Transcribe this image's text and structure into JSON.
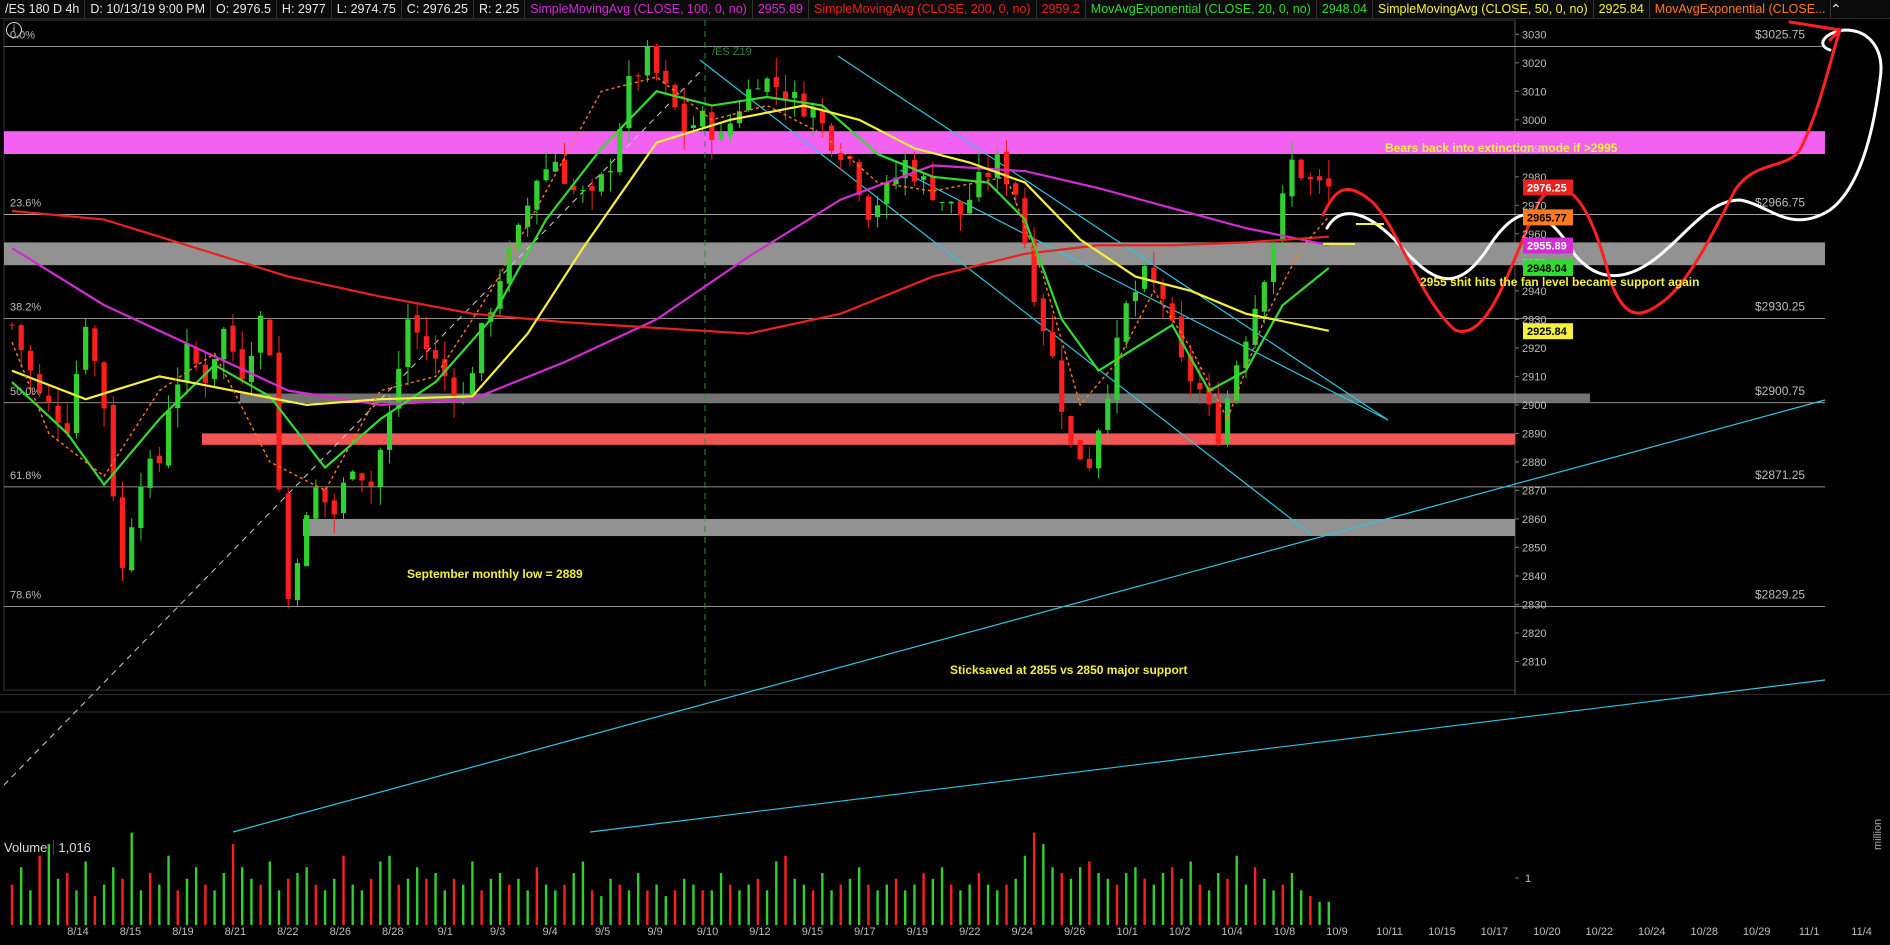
{
  "header": {
    "symbol": "/ES 180 D 4h",
    "date": "D: 10/13/19 9:00 PM",
    "open": "O: 2976.5",
    "high": "H: 2977",
    "low": "L: 2974.75",
    "close": "C: 2976.25",
    "range": "R: 2.25",
    "studies": [
      {
        "label": "SimpleMovingAvg (CLOSE, 100, 0, no)",
        "value": "2955.89",
        "color": "#d22cd2"
      },
      {
        "label": "SimpleMovingAvg (CLOSE, 200, 0, no)",
        "value": "2959.2",
        "color": "#e8221c"
      },
      {
        "label": "MovAvgExponential (CLOSE, 20, 0, no)",
        "value": "2948.04",
        "color": "#2fdc2f"
      },
      {
        "label": "SimpleMovingAvg (CLOSE, 50, 0, no)",
        "value": "2925.84",
        "color": "#f5f03a"
      },
      {
        "label": "MovAvgExponential (CLOSE...",
        "value": "",
        "color": "#ff7a1a"
      }
    ]
  },
  "volume_panel": {
    "title": "Volume",
    "value": "1,016",
    "axis_tick": "1",
    "axis_unit": "million"
  },
  "fib_labels": [
    "0.0%",
    "23.6%",
    "38.2%",
    "50.0%",
    "61.8%",
    "78.6%"
  ],
  "level_labels": [
    "$3025.75",
    "$2966.75",
    "$2930.25",
    "$2900.75",
    "$2871.25",
    "$2829.25"
  ],
  "price_badges": [
    {
      "text": "2976.25",
      "bg": "#e8221c",
      "fg": "#ffffff"
    },
    {
      "text": "2965.77",
      "bg": "#ff7a1a",
      "fg": "#000000"
    },
    {
      "text": "2955.89",
      "bg": "#d22cd2",
      "fg": "#ffffff"
    },
    {
      "text": "2948.04",
      "bg": "#2fdc2f",
      "fg": "#000000"
    },
    {
      "text": "2925.84",
      "bg": "#f5f03a",
      "fg": "#000000"
    }
  ],
  "annotations": [
    "Bears back into extinction mode if >2995",
    "2955 shit hits the fan level became support again",
    "September monthly low = 2889",
    "Sticksaved at 2855 vs 2850 major support"
  ],
  "chart_data": {
    "type": "candlestick",
    "ylim": [
      2800,
      3035
    ],
    "y_ticks": [
      3030,
      3020,
      3010,
      3000,
      2990,
      2980,
      2970,
      2960,
      2950,
      2940,
      2930,
      2920,
      2910,
      2900,
      2890,
      2880,
      2870,
      2860,
      2850,
      2840,
      2830,
      2820,
      2810
    ],
    "x_tick_labels": [
      "8/14",
      "8/15",
      "8/19",
      "8/21",
      "8/22",
      "8/26",
      "8/28",
      "9/1",
      "9/3",
      "9/4",
      "9/5",
      "9/9",
      "9/10",
      "9/12",
      "9/15",
      "9/17",
      "9/19",
      "9/22",
      "9/24",
      "9/26",
      "10/1",
      "10/2",
      "10/4",
      "10/8",
      "10/9",
      "10/11",
      "10/15",
      "10/17",
      "10/20",
      "10/22",
      "10/24",
      "10/28",
      "10/29",
      "11/1",
      "11/4"
    ],
    "zones": [
      {
        "name": "resistance-zone",
        "from": 2988,
        "to": 2996,
        "color": "#ff66ff"
      },
      {
        "name": "support-zone-2955",
        "from": 2949,
        "to": 2957,
        "color": "#9a9a9a"
      },
      {
        "name": "zone-2900",
        "from": 2901,
        "to": 2904,
        "color": "#9a9a9a"
      },
      {
        "name": "september-low-zone",
        "from": 2886,
        "to": 2890,
        "color": "#ff5a5a"
      },
      {
        "name": "zone-2855",
        "from": 2854,
        "to": 2860,
        "color": "#9a9a9a"
      }
    ],
    "fib_levels": [
      3025.75,
      2966.75,
      2930.25,
      2900.75,
      2871.25,
      2829.25
    ],
    "price_path": [
      [
        0,
        2928
      ],
      [
        3,
        2903
      ],
      [
        6,
        2893
      ],
      [
        8,
        2930
      ],
      [
        10,
        2900
      ],
      [
        11,
        2870
      ],
      [
        12,
        2842
      ],
      [
        13,
        2860
      ],
      [
        14,
        2875
      ],
      [
        16,
        2880
      ],
      [
        17,
        2900
      ],
      [
        19,
        2918
      ],
      [
        21,
        2910
      ],
      [
        23,
        2926
      ],
      [
        25,
        2912
      ],
      [
        27,
        2930
      ],
      [
        28,
        2920
      ],
      [
        29,
        2870
      ],
      [
        30,
        2832
      ],
      [
        31,
        2848
      ],
      [
        33,
        2870
      ],
      [
        35,
        2862
      ],
      [
        37,
        2880
      ],
      [
        39,
        2872
      ],
      [
        41,
        2896
      ],
      [
        43,
        2930
      ],
      [
        45,
        2920
      ],
      [
        47,
        2910
      ],
      [
        49,
        2902
      ],
      [
        51,
        2925
      ],
      [
        53,
        2945
      ],
      [
        55,
        2960
      ],
      [
        57,
        2980
      ],
      [
        59,
        2986
      ],
      [
        61,
        2975
      ],
      [
        63,
        2972
      ],
      [
        65,
        2985
      ],
      [
        67,
        3012
      ],
      [
        69,
        3022
      ],
      [
        71,
        3010
      ],
      [
        73,
        2997
      ],
      [
        75,
        3000
      ],
      [
        77,
        2993
      ],
      [
        79,
        3005
      ],
      [
        81,
        3015
      ],
      [
        83,
        3012
      ],
      [
        85,
        3007
      ],
      [
        87,
        3003
      ],
      [
        89,
        2993
      ],
      [
        91,
        2986
      ],
      [
        93,
        2968
      ],
      [
        95,
        2975
      ],
      [
        97,
        2985
      ],
      [
        99,
        2978
      ],
      [
        101,
        2972
      ],
      [
        103,
        2967
      ],
      [
        105,
        2978
      ],
      [
        107,
        2985
      ],
      [
        109,
        2975
      ],
      [
        111,
        2940
      ],
      [
        113,
        2916
      ],
      [
        115,
        2885
      ],
      [
        117,
        2880
      ],
      [
        119,
        2906
      ],
      [
        121,
        2934
      ],
      [
        123,
        2945
      ],
      [
        125,
        2938
      ],
      [
        127,
        2914
      ],
      [
        129,
        2905
      ],
      [
        131,
        2890
      ],
      [
        133,
        2915
      ],
      [
        135,
        2935
      ],
      [
        137,
        2958
      ],
      [
        139,
        2985
      ],
      [
        141,
        2978
      ],
      [
        143,
        2976
      ]
    ],
    "series": [
      {
        "name": "SMA 100",
        "color": "#d22cd2",
        "values": [
          [
            0,
            2955
          ],
          [
            10,
            2935
          ],
          [
            20,
            2920
          ],
          [
            30,
            2905
          ],
          [
            40,
            2900
          ],
          [
            50,
            2902
          ],
          [
            60,
            2915
          ],
          [
            70,
            2930
          ],
          [
            80,
            2952
          ],
          [
            90,
            2972
          ],
          [
            100,
            2984
          ],
          [
            110,
            2982
          ],
          [
            118,
            2976
          ],
          [
            126,
            2969
          ],
          [
            134,
            2962
          ],
          [
            143,
            2956
          ]
        ]
      },
      {
        "name": "SMA 200",
        "color": "#e8221c",
        "values": [
          [
            0,
            2968
          ],
          [
            10,
            2965
          ],
          [
            20,
            2955
          ],
          [
            30,
            2945
          ],
          [
            40,
            2938
          ],
          [
            50,
            2932
          ],
          [
            60,
            2929
          ],
          [
            70,
            2927
          ],
          [
            80,
            2925
          ],
          [
            90,
            2932
          ],
          [
            100,
            2945
          ],
          [
            110,
            2953
          ],
          [
            118,
            2956
          ],
          [
            126,
            2956
          ],
          [
            134,
            2957
          ],
          [
            143,
            2959
          ]
        ]
      },
      {
        "name": "EMA 20",
        "color": "#2fdc2f",
        "values": [
          [
            0,
            2908
          ],
          [
            6,
            2890
          ],
          [
            10,
            2872
          ],
          [
            16,
            2895
          ],
          [
            22,
            2914
          ],
          [
            28,
            2903
          ],
          [
            34,
            2878
          ],
          [
            40,
            2895
          ],
          [
            46,
            2908
          ],
          [
            52,
            2930
          ],
          [
            58,
            2965
          ],
          [
            64,
            2990
          ],
          [
            70,
            3010
          ],
          [
            76,
            3005
          ],
          [
            82,
            3008
          ],
          [
            88,
            3005
          ],
          [
            94,
            2988
          ],
          [
            100,
            2980
          ],
          [
            106,
            2978
          ],
          [
            110,
            2965
          ],
          [
            114,
            2930
          ],
          [
            118,
            2912
          ],
          [
            122,
            2920
          ],
          [
            126,
            2928
          ],
          [
            130,
            2905
          ],
          [
            134,
            2912
          ],
          [
            138,
            2935
          ],
          [
            143,
            2948
          ]
        ]
      },
      {
        "name": "SMA 50",
        "color": "#f5f03a",
        "values": [
          [
            0,
            2912
          ],
          [
            8,
            2902
          ],
          [
            16,
            2910
          ],
          [
            24,
            2905
          ],
          [
            32,
            2900
          ],
          [
            40,
            2902
          ],
          [
            50,
            2903
          ],
          [
            56,
            2925
          ],
          [
            62,
            2955
          ],
          [
            70,
            2992
          ],
          [
            78,
            3000
          ],
          [
            86,
            3005
          ],
          [
            92,
            3000
          ],
          [
            98,
            2990
          ],
          [
            104,
            2985
          ],
          [
            110,
            2978
          ],
          [
            116,
            2958
          ],
          [
            122,
            2945
          ],
          [
            128,
            2940
          ],
          [
            134,
            2932
          ],
          [
            143,
            2926
          ]
        ]
      },
      {
        "name": "EMA orange",
        "color": "#ff7a1a",
        "values": [
          [
            0,
            2922
          ],
          [
            4,
            2890
          ],
          [
            10,
            2875
          ],
          [
            16,
            2905
          ],
          [
            22,
            2918
          ],
          [
            28,
            2880
          ],
          [
            34,
            2870
          ],
          [
            40,
            2905
          ],
          [
            46,
            2910
          ],
          [
            52,
            2940
          ],
          [
            58,
            2975
          ],
          [
            64,
            3010
          ],
          [
            70,
            3015
          ],
          [
            76,
            3000
          ],
          [
            82,
            3005
          ],
          [
            88,
            2995
          ],
          [
            94,
            2978
          ],
          [
            100,
            2975
          ],
          [
            108,
            2980
          ],
          [
            112,
            2945
          ],
          [
            116,
            2900
          ],
          [
            120,
            2915
          ],
          [
            124,
            2940
          ],
          [
            128,
            2920
          ],
          [
            132,
            2895
          ],
          [
            136,
            2930
          ],
          [
            140,
            2955
          ],
          [
            143,
            2966
          ]
        ]
      }
    ],
    "volume": [
      0.35,
      0.5,
      0.3,
      0.6,
      0.7,
      0.4,
      0.45,
      0.3,
      0.55,
      0.25,
      0.35,
      0.5,
      0.4,
      0.8,
      0.3,
      0.45,
      0.35,
      0.6,
      0.3,
      0.4,
      0.5,
      0.35,
      0.3,
      0.45,
      0.7,
      0.5,
      0.4,
      0.35,
      0.55,
      0.3,
      0.4,
      0.45,
      0.5,
      0.35,
      0.3,
      0.4,
      0.6,
      0.35,
      0.3,
      0.4,
      0.55,
      0.6,
      0.35,
      0.4,
      0.5,
      0.4,
      0.45,
      0.3,
      0.4,
      0.35,
      0.55,
      0.3,
      0.4,
      0.45,
      0.35,
      0.4,
      0.3,
      0.5,
      0.35,
      0.3,
      0.35,
      0.45,
      0.55,
      0.3,
      0.25,
      0.4,
      0.35,
      0.3,
      0.45,
      0.3,
      0.35,
      0.25,
      0.3,
      0.4,
      0.35,
      0.3,
      0.3,
      0.45,
      0.35,
      0.3,
      0.35,
      0.4,
      0.3,
      0.55,
      0.6,
      0.4,
      0.35,
      0.3,
      0.45,
      0.3,
      0.35,
      0.4,
      0.5,
      0.35,
      0.3,
      0.35,
      0.4,
      0.3,
      0.35,
      0.45,
      0.4,
      0.5,
      0.35,
      0.3,
      0.35,
      0.45,
      0.35,
      0.3,
      0.35,
      0.4,
      0.6,
      0.8,
      0.7,
      0.5,
      0.45,
      0.4,
      0.5,
      0.55,
      0.45,
      0.4,
      0.35,
      0.45,
      0.5,
      0.4,
      0.35,
      0.45,
      0.5,
      0.4,
      0.55,
      0.35,
      0.3,
      0.45,
      0.4,
      0.6,
      0.35,
      0.5,
      0.4,
      0.3,
      0.35,
      0.45,
      0.3,
      0.25,
      0.2,
      0.2
    ]
  }
}
